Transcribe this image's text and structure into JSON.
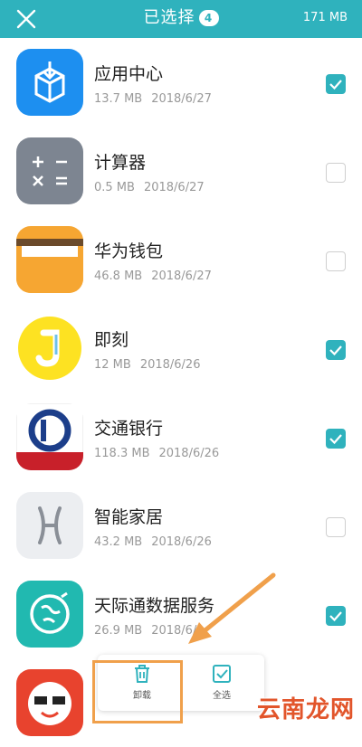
{
  "header": {
    "title": "已选择",
    "selected_count": "4",
    "total_size": "171 MB"
  },
  "apps": [
    {
      "name": "应用中心",
      "size": "13.7 MB",
      "date": "2018/6/27",
      "checked": true,
      "icon": "app-center-icon"
    },
    {
      "name": "计算器",
      "size": "0.5 MB",
      "date": "2018/6/27",
      "checked": false,
      "icon": "calculator-icon"
    },
    {
      "name": "华为钱包",
      "size": "46.8 MB",
      "date": "2018/6/27",
      "checked": false,
      "icon": "wallet-icon"
    },
    {
      "name": "即刻",
      "size": "12 MB",
      "date": "2018/6/26",
      "checked": true,
      "icon": "j-app-icon"
    },
    {
      "name": "交通银行",
      "size": "118.3 MB",
      "date": "2018/6/26",
      "checked": true,
      "icon": "bank-icon"
    },
    {
      "name": "智能家居",
      "size": "43.2 MB",
      "date": "2018/6/26",
      "checked": false,
      "icon": "smart-home-icon"
    },
    {
      "name": "天际通数据服务",
      "size": "26.9 MB",
      "date": "2018/6/",
      "checked": true,
      "icon": "globe-icon"
    },
    {
      "name": "",
      "size": "",
      "date": "",
      "checked": false,
      "icon": "emoji-app-icon"
    }
  ],
  "actions": {
    "uninstall": "卸载",
    "select_all": "全选"
  },
  "watermark": "云南龙网",
  "colors": {
    "accent": "#2fb2bd",
    "highlight": "#f0a04b"
  }
}
